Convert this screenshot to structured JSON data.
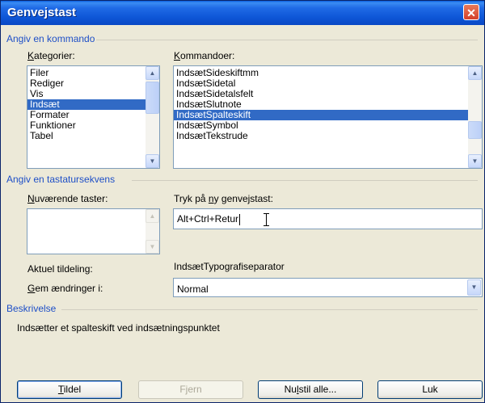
{
  "window": {
    "title": "Genvejstast",
    "close_glyph": "✕"
  },
  "section_command": {
    "label": "Angiv en kommando"
  },
  "categories": {
    "label_prefix": "K",
    "label_rest": "ategorier:",
    "items": [
      "Filer",
      "Rediger",
      "Vis",
      "Indsæt",
      "Formater",
      "Funktioner",
      "Tabel"
    ],
    "selected": "Indsæt"
  },
  "commands": {
    "label_prefix": "K",
    "label_rest": "ommandoer:",
    "items": [
      "IndsætSideskiftmm",
      "IndsætSidetal",
      "IndsætSidetalsfelt",
      "IndsætSlutnote",
      "IndsætSpalteskift",
      "IndsætSymbol",
      "IndsætTekstrude"
    ],
    "selected": "IndsætSpalteskift"
  },
  "section_keys": {
    "label": "Angiv en tastatursekvens"
  },
  "current_keys": {
    "label_a": "N",
    "label_b": "u",
    "label_c": "værende taster:",
    "value": ""
  },
  "new_key": {
    "label_a": "Tryk på ",
    "label_b": "n",
    "label_c": "y genvejstast:",
    "value": "Alt+Ctrl+Retur"
  },
  "assignment": {
    "label": "Aktuel tildeling:",
    "value": "IndsætTypografiseparator"
  },
  "save_in": {
    "label_a": "G",
    "label_b": "em ændringer i:",
    "value": "Normal"
  },
  "section_description": {
    "label": "Beskrivelse",
    "text": "Indsætter et spalteskift ved indsætningspunktet"
  },
  "buttons": {
    "assign_u": "T",
    "assign_rest": "ildel",
    "remove": "Fjern",
    "reset_a": "Nu",
    "reset_u": "l",
    "reset_c": "stil alle...",
    "close": "Luk"
  },
  "icons": {
    "scroll_up": "▲",
    "scroll_down": "▼",
    "combo_arrow": "▼"
  },
  "colors": {
    "title_bar": "#1f6ae6",
    "section": "#1e4fc7",
    "selection": "#316ac5",
    "dialog_bg": "#ece9d8"
  }
}
